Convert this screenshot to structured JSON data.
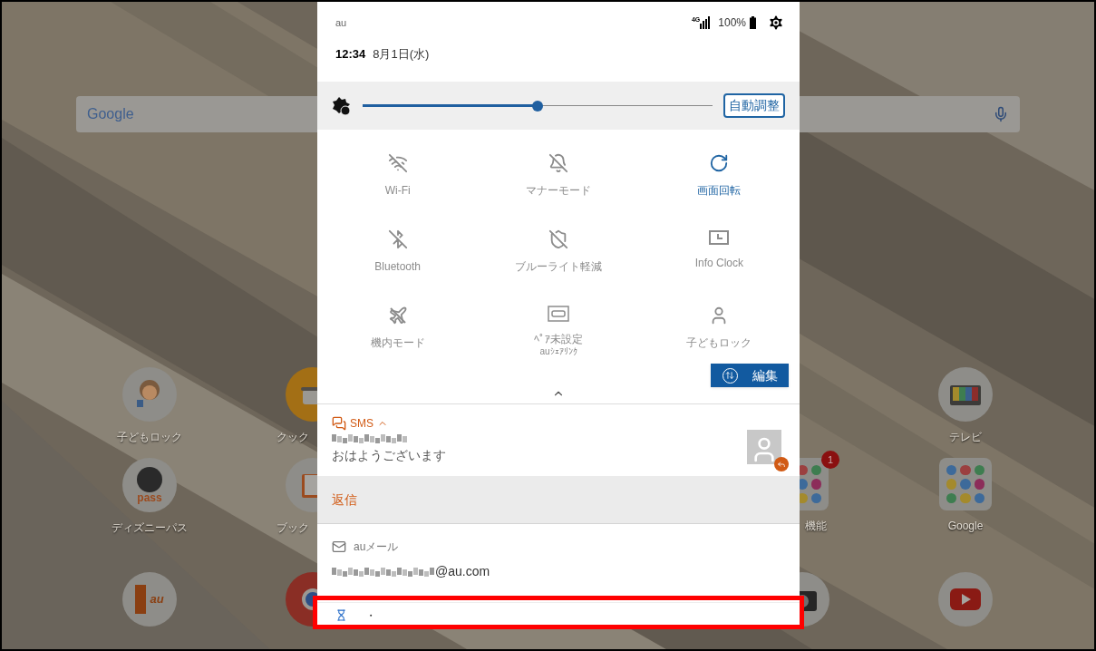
{
  "home_screen": {
    "search_bar": {
      "logo": "Google"
    },
    "apps": [
      {
        "kind": "child",
        "label": "子どもロック"
      },
      {
        "kind": "pot",
        "label": "クック"
      },
      {
        "kind": "tv",
        "label": "テレビ"
      },
      {
        "kind": "pass",
        "label": "ディズニーパス",
        "icon_text": "pass"
      },
      {
        "kind": "book",
        "label": "ブック"
      },
      {
        "kind": "folder",
        "label": "機能",
        "badge": "1"
      },
      {
        "kind": "folder",
        "label": "Google"
      },
      {
        "kind": "door",
        "icon_text": "au"
      },
      {
        "kind": "browser"
      },
      {
        "kind": "camera"
      },
      {
        "kind": "play"
      }
    ]
  },
  "notification_panel": {
    "carrier": "au",
    "network": "4G",
    "battery": "100%",
    "time": "12:34",
    "date": "8月1日(水)",
    "brightness": {
      "level": 0.5,
      "auto_button": {
        "label": "自動調整",
        "on": true
      }
    },
    "tiles": [
      {
        "label": "Wi-Fi",
        "on": false
      },
      {
        "label": "マナーモード",
        "on": false
      },
      {
        "label": "画面回転",
        "on": true
      },
      {
        "label": "Bluetooth",
        "on": false
      },
      {
        "label": "ブルーライト軽減",
        "on": false
      },
      {
        "label": "Info Clock",
        "on": false
      },
      {
        "label": "機内モード",
        "on": false
      },
      {
        "label": "ﾍﾟｱ未設定",
        "sublabel": "auｼｪｱﾘﾝｸ",
        "on": false
      },
      {
        "label": "子どもロック",
        "on": false
      }
    ],
    "edit_button": "編集",
    "notifications": [
      {
        "kind": "sms",
        "app": "SMS",
        "expanded": true,
        "message": "おはようございます",
        "action": "返信"
      },
      {
        "kind": "mail",
        "app": "auメール",
        "address": "@au.com"
      },
      {
        "kind": "pending",
        "text": "・"
      }
    ]
  }
}
